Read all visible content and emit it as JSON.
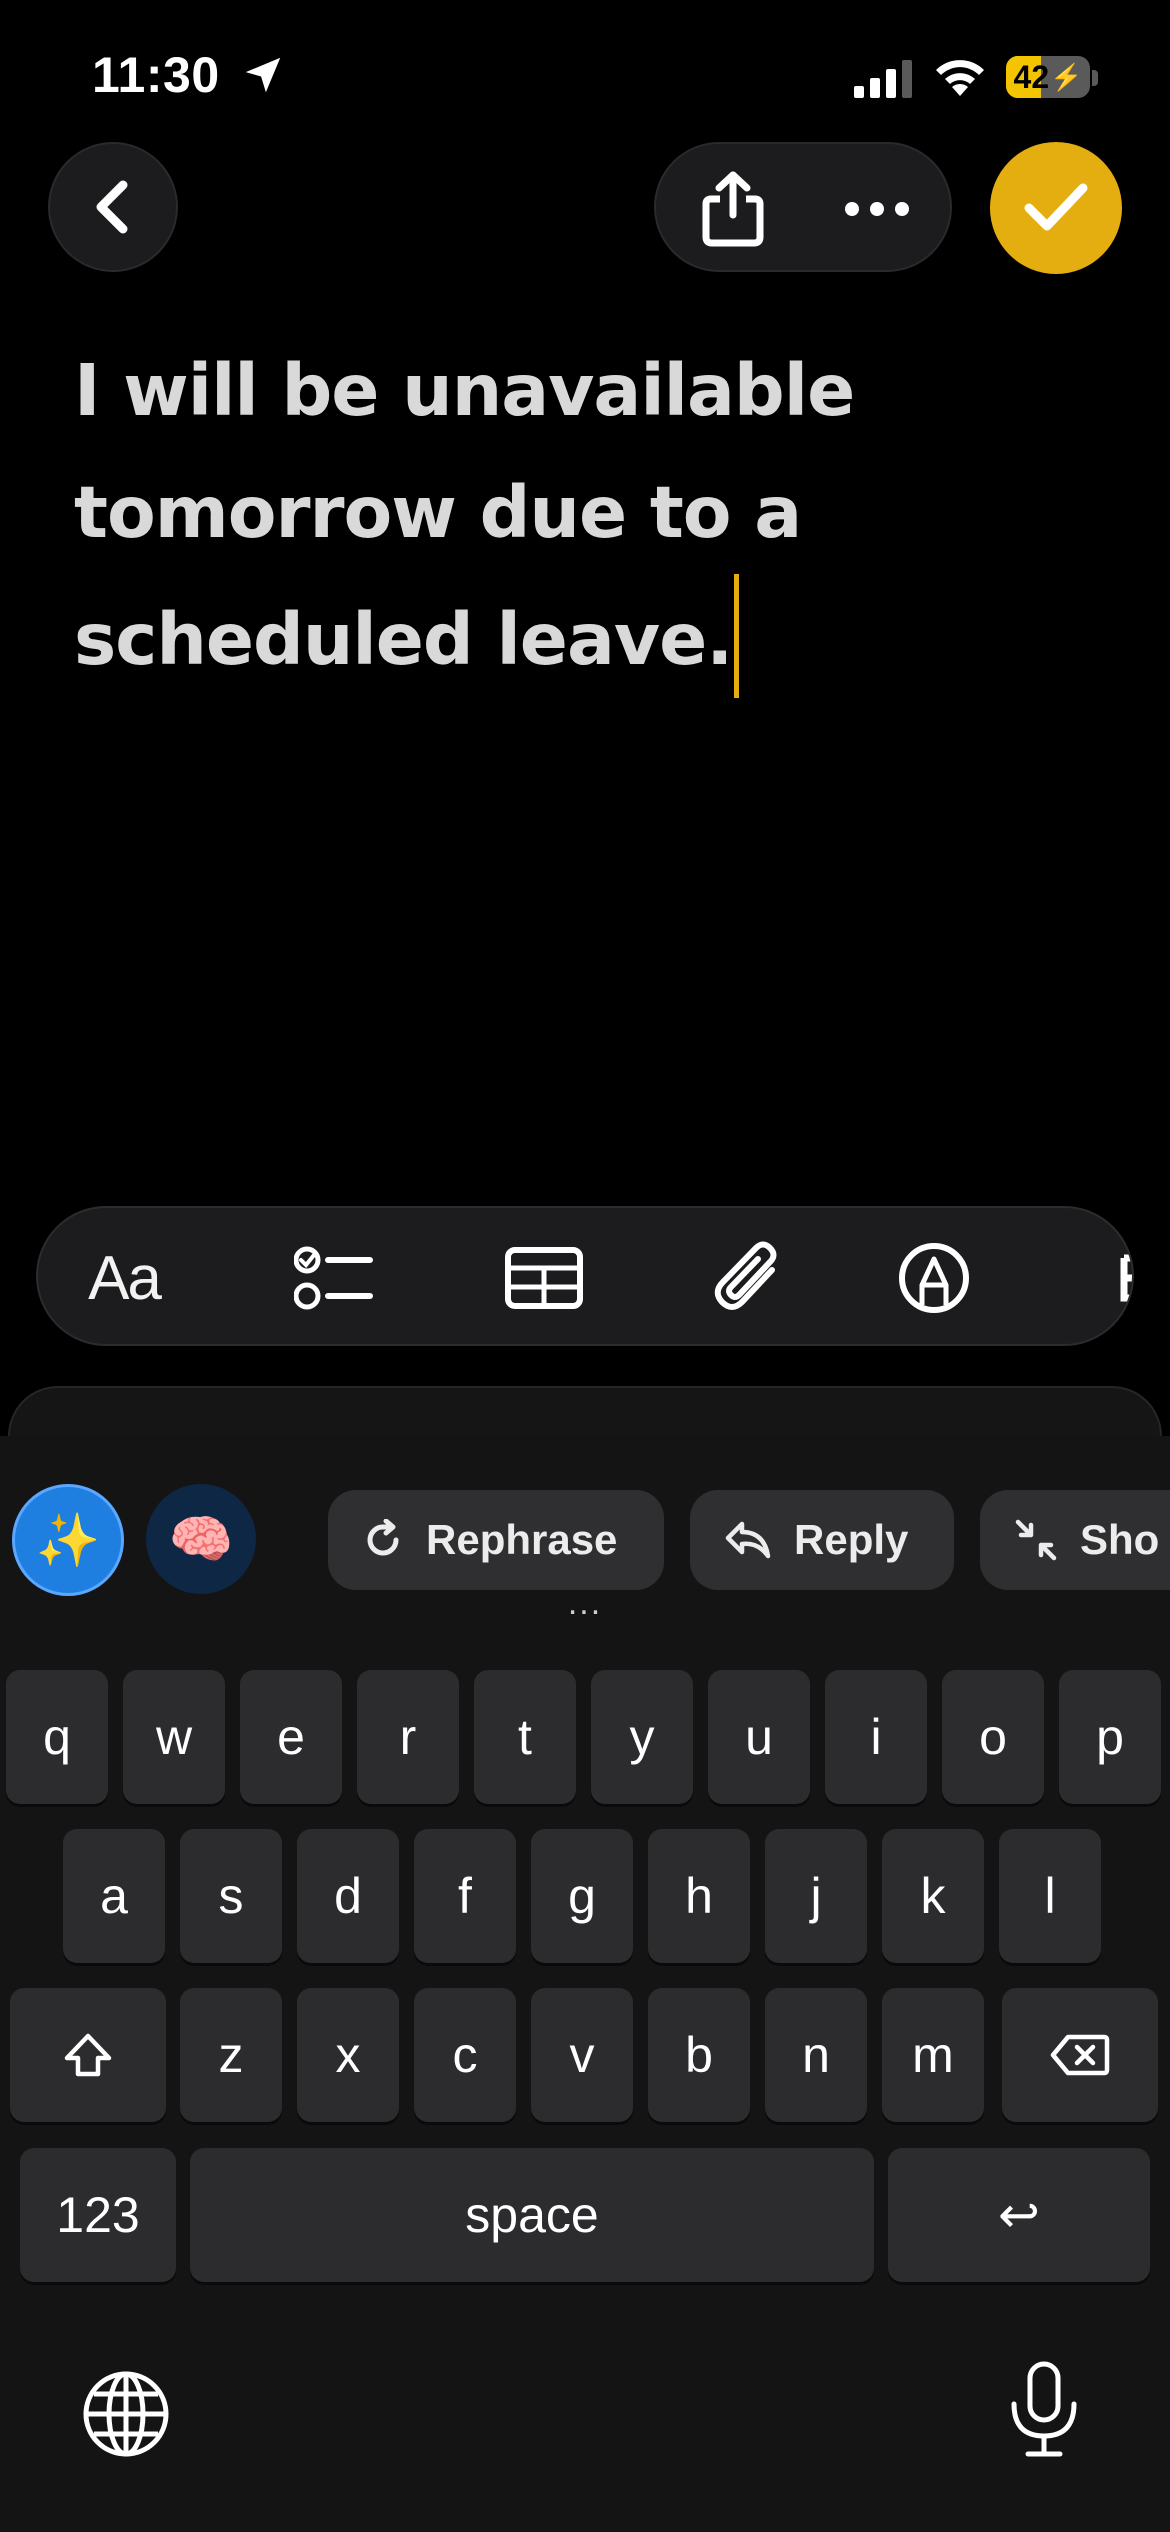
{
  "status_bar": {
    "time": "11:30",
    "battery_level": "42",
    "battery_fraction": 0.42,
    "icons": [
      "location-arrow-icon",
      "cellular-signal-icon",
      "wifi-icon",
      "battery-charging-icon"
    ]
  },
  "nav": {
    "back_icon": "chevron-left-icon",
    "share_icon": "share-icon",
    "more_icon": "ellipsis-icon",
    "done_icon": "checkmark-icon",
    "accent_color": "#e4ae10"
  },
  "editor": {
    "text": "I will be unavailable tomorrow due to a scheduled leave."
  },
  "format_toolbar": {
    "text_style_label": "Aa",
    "icons": [
      "text-style-icon",
      "checklist-icon",
      "table-icon",
      "attachment-icon",
      "markup-icon",
      "more-tools-icon"
    ]
  },
  "ai_bar": {
    "sparkle_emoji": "✨",
    "brain_emoji": "🧠",
    "chips": [
      {
        "label": "Rephrase",
        "icon": "rephrase-icon"
      },
      {
        "label": "Reply",
        "icon": "reply-icon"
      },
      {
        "label": "Sho",
        "icon": "shorten-icon"
      }
    ],
    "more_dots": "..."
  },
  "keyboard": {
    "row1": [
      "q",
      "w",
      "e",
      "r",
      "t",
      "y",
      "u",
      "i",
      "o",
      "p"
    ],
    "row2": [
      "a",
      "s",
      "d",
      "f",
      "g",
      "h",
      "j",
      "k",
      "l"
    ],
    "row3": [
      "z",
      "x",
      "c",
      "v",
      "b",
      "n",
      "m"
    ],
    "numbers_label": "123",
    "space_label": "space",
    "return_glyph": "↩",
    "shift_icon": "shift-icon",
    "delete_icon": "delete-icon",
    "globe_icon": "globe-icon",
    "mic_icon": "microphone-icon"
  }
}
